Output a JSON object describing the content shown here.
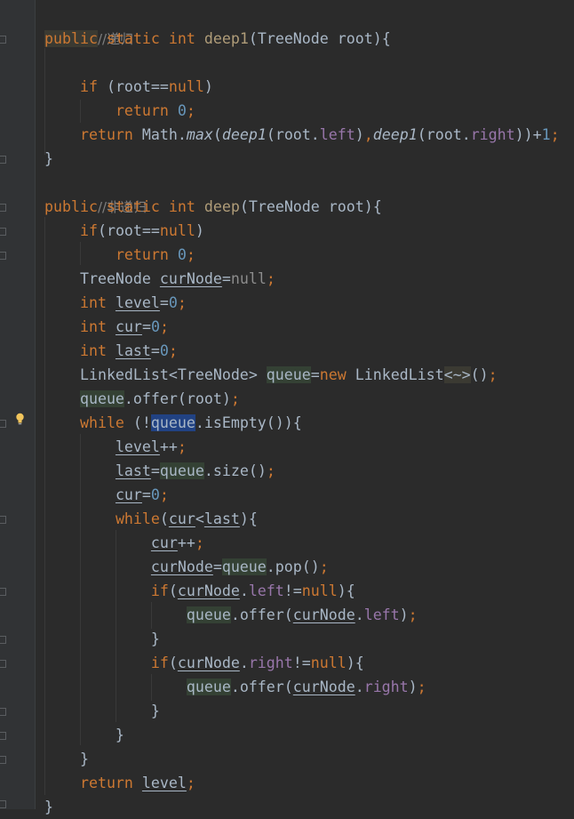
{
  "editor": {
    "language": "Java",
    "lines": [
      "//递归",
      "public static int deep1(TreeNode root){",
      "",
      "    if (root==null)",
      "        return 0;",
      "    return Math.max(deep1(root.left),deep1(root.right))+1;",
      "}",
      "//非递归",
      "public static int deep(TreeNode root){",
      "    if(root==null)",
      "        return 0;",
      "    TreeNode curNode=null;",
      "    int level=0;",
      "    int cur=0;",
      "    int last=0;",
      "    LinkedList<TreeNode> queue=new LinkedList<~>();",
      "    queue.offer(root);",
      "    while (!queue.isEmpty()){",
      "        level++;",
      "        last=queue.size();",
      "        cur=0;",
      "        while(cur<last){",
      "            cur++;",
      "            curNode=queue.pop();",
      "            if(curNode.left!=null){",
      "                queue.offer(curNode.left);",
      "            }",
      "            if(curNode.right!=null){",
      "                queue.offer(curNode.right);",
      "            }",
      "        }",
      "    }",
      "    return level;",
      "}"
    ]
  },
  "tokens": {
    "comment_recursive": "//递归",
    "comment_nonrecursive": "//非递归",
    "kw_public": "public",
    "kw_static": "static",
    "kw_int": "int",
    "kw_if": "if",
    "kw_return": "return",
    "kw_null": "null",
    "kw_new": "new",
    "kw_while": "while",
    "method_deep1": "deep1",
    "method_deep": "deep",
    "type_treenode": "TreeNode",
    "type_linkedlist": "LinkedList",
    "class_math": "Math",
    "method_max": "max",
    "param_root": "root",
    "field_left": "left",
    "field_right": "right",
    "var_curnode": "curNode",
    "var_level": "level",
    "var_cur": "cur",
    "var_last": "last",
    "var_queue": "queue",
    "num_zero": "0",
    "num_one": "1",
    "diamond": "<~>",
    "call_offer": "offer",
    "call_isempty": "isEmpty",
    "call_size": "size",
    "call_pop": "pop"
  },
  "colors": {
    "background": "#2b2b2b",
    "gutter": "#313335",
    "keyword": "#cc7832",
    "number": "#6897bb",
    "comment": "#808080",
    "field": "#9876aa",
    "default_text": "#a9b7c6",
    "selection": "#214283",
    "identifier_highlight": "#344134"
  },
  "gutter_icons": [
    "lightbulb-icon",
    "fold-marker-icon"
  ]
}
